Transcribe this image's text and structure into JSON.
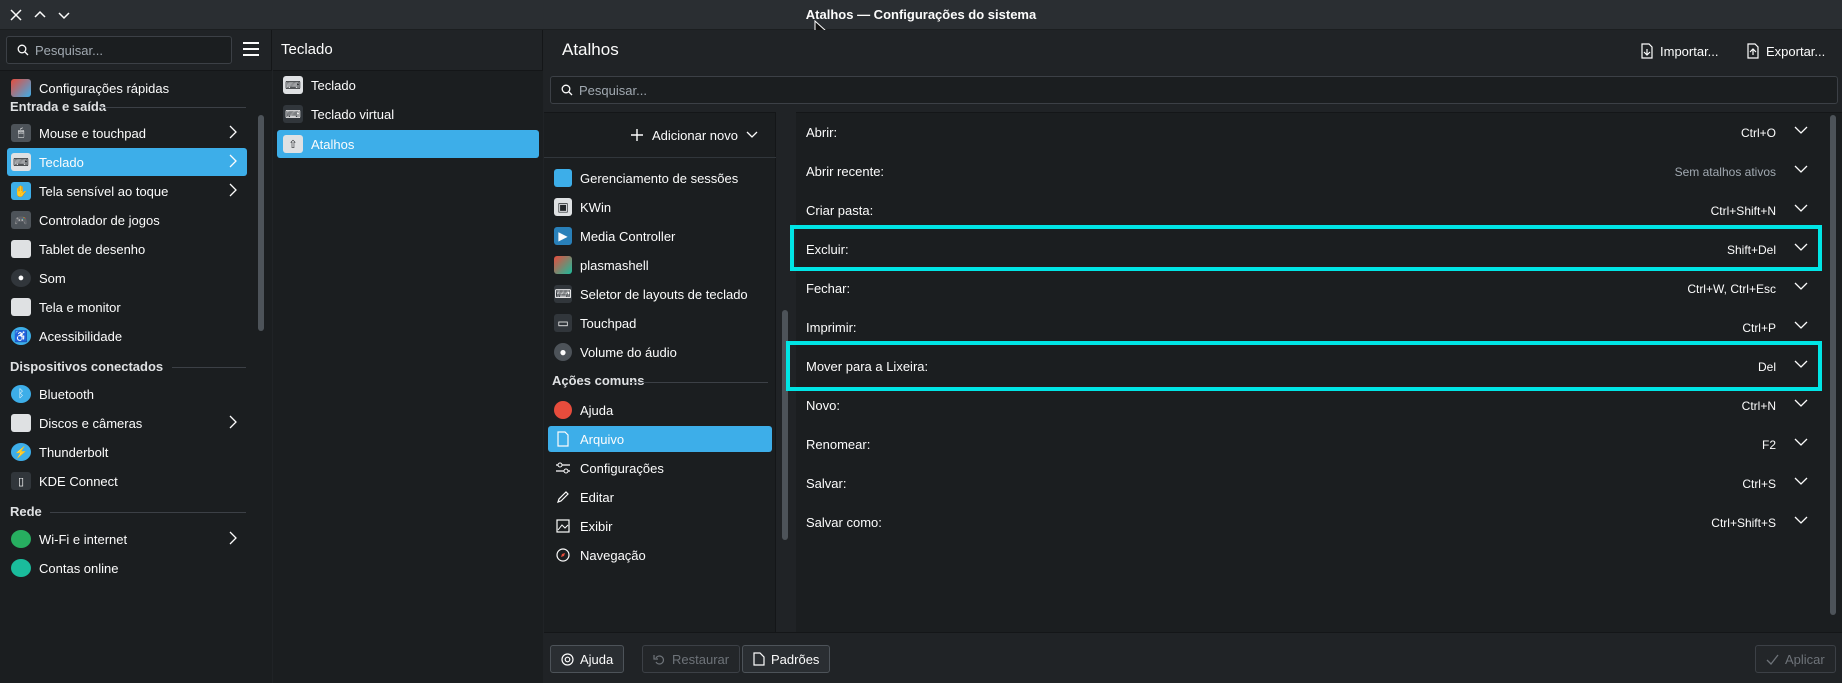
{
  "window": {
    "title": "Atalhos — Configurações do sistema"
  },
  "sidebar": {
    "search_placeholder": "Pesquisar...",
    "quick_settings": "Configurações rápidas",
    "cat_input": "Entrada e saída",
    "items_input": [
      {
        "label": "Mouse e touchpad",
        "icon": "mouse-icon"
      },
      {
        "label": "Teclado",
        "icon": "keyboard-icon"
      },
      {
        "label": "Tela sensível ao toque",
        "icon": "touchscreen-icon"
      },
      {
        "label": "Controlador de jogos",
        "icon": "gamepad-icon"
      },
      {
        "label": "Tablet de desenho",
        "icon": "tablet-icon"
      },
      {
        "label": "Som",
        "icon": "speaker-icon"
      },
      {
        "label": "Tela e monitor",
        "icon": "monitor-icon"
      },
      {
        "label": "Acessibilidade",
        "icon": "accessibility-icon"
      }
    ],
    "cat_devices": "Dispositivos conectados",
    "items_devices": [
      {
        "label": "Bluetooth",
        "icon": "bluetooth-icon"
      },
      {
        "label": "Discos e câmeras",
        "icon": "disk-icon"
      },
      {
        "label": "Thunderbolt",
        "icon": "thunderbolt-icon"
      },
      {
        "label": "KDE Connect",
        "icon": "kdeconnect-icon"
      }
    ],
    "cat_network": "Rede",
    "items_network": [
      {
        "label": "Wi-Fi e internet",
        "icon": "globe-icon"
      },
      {
        "label": "Contas online",
        "icon": "online-accounts-icon"
      }
    ]
  },
  "subpanel": {
    "title": "Teclado",
    "items": [
      {
        "label": "Teclado"
      },
      {
        "label": "Teclado virtual"
      },
      {
        "label": "Atalhos"
      }
    ]
  },
  "main": {
    "title": "Atalhos",
    "import_label": "Importar...",
    "export_label": "Exportar...",
    "search_placeholder": "Pesquisar...",
    "add_new_label": "Adicionar novo",
    "components": [
      {
        "label": "Gerenciamento de sessões"
      },
      {
        "label": "KWin"
      },
      {
        "label": "Media Controller"
      },
      {
        "label": "plasmashell"
      },
      {
        "label": "Seletor de layouts de teclado"
      },
      {
        "label": "Touchpad"
      },
      {
        "label": "Volume do áudio"
      }
    ],
    "common_header": "Ações comuns",
    "common": [
      {
        "label": "Ajuda"
      },
      {
        "label": "Arquivo"
      },
      {
        "label": "Configurações"
      },
      {
        "label": "Editar"
      },
      {
        "label": "Exibir"
      },
      {
        "label": "Navegação"
      }
    ],
    "shortcuts": [
      {
        "label": "Abrir:",
        "value": "Ctrl+O"
      },
      {
        "label": "Abrir recente:",
        "value": "Sem atalhos ativos"
      },
      {
        "label": "Criar pasta:",
        "value": "Ctrl+Shift+N"
      },
      {
        "label": "Excluir:",
        "value": "Shift+Del"
      },
      {
        "label": "Fechar:",
        "value": "Ctrl+W, Ctrl+Esc"
      },
      {
        "label": "Imprimir:",
        "value": "Ctrl+P"
      },
      {
        "label": "Mover para a Lixeira:",
        "value": "Del"
      },
      {
        "label": "Novo:",
        "value": "Ctrl+N"
      },
      {
        "label": "Renomear:",
        "value": "F2"
      },
      {
        "label": "Salvar:",
        "value": "Ctrl+S"
      },
      {
        "label": "Salvar como:",
        "value": "Ctrl+Shift+S"
      }
    ]
  },
  "footer": {
    "help_label": "Ajuda",
    "reset_label": "Restaurar",
    "defaults_label": "Padrões",
    "apply_label": "Aplicar"
  },
  "colors": {
    "accent": "#3daee9",
    "highlight": "#00e5e5",
    "background": "#1b1e20"
  }
}
